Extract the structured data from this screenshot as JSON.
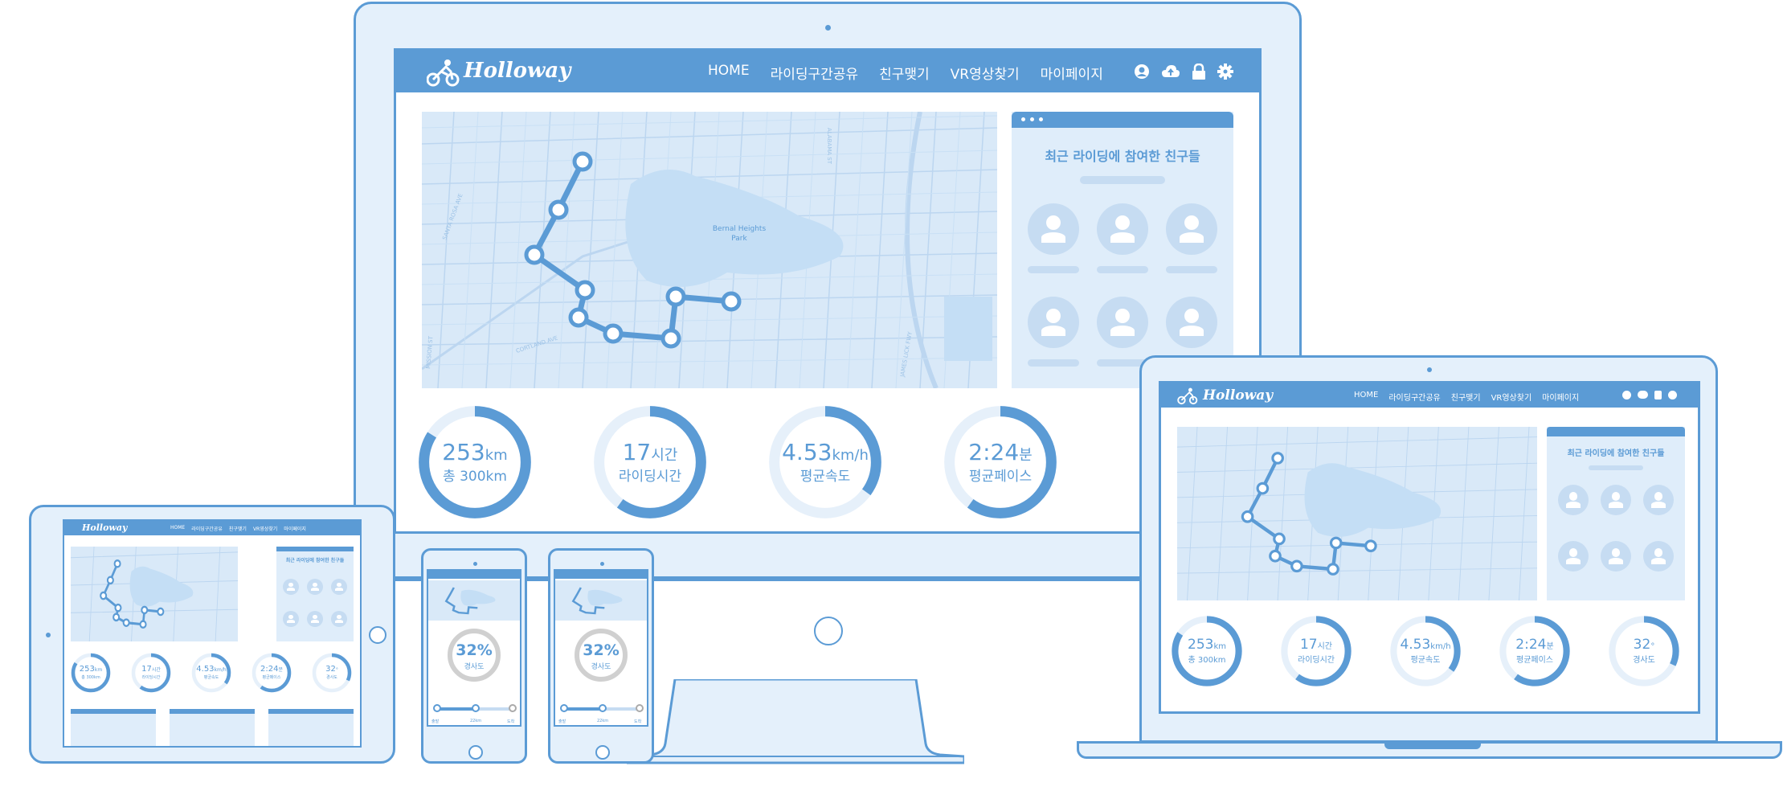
{
  "brand": {
    "name": "Holloway"
  },
  "nav": {
    "items": [
      "HOME",
      "라이딩구간공유",
      "친구맺기",
      "VR영상찾기",
      "마이페이지"
    ]
  },
  "friends_card": {
    "title": "최근 라이딩에 참여한 친구들"
  },
  "map": {
    "park_label": "Bernal Heights\nPark",
    "streets": [
      "CORTLAND AVE",
      "SANTA ROSA AVE",
      "MISSION ST",
      "JAMES LICK FWY",
      "ALABAMA ST"
    ]
  },
  "stats": [
    {
      "value": "253",
      "unit": "km",
      "caption": "총 300km",
      "fraction": 0.84
    },
    {
      "value": "17",
      "unit": "시간",
      "caption": "라이딩시간",
      "fraction": 0.6
    },
    {
      "value": "4.53",
      "unit": "km/h",
      "caption": "평균속도",
      "fraction": 0.35
    },
    {
      "value": "2:24",
      "unit": "분",
      "caption": "평균페이스",
      "fraction": 0.6
    },
    {
      "value": "32",
      "unit": "°",
      "caption": "경사도",
      "fraction": 0.32
    }
  ],
  "phone": {
    "gauge_value": "32%",
    "gauge_caption": "경사도",
    "slider": [
      "출발",
      "22km",
      "도착"
    ]
  },
  "colors": {
    "accent": "#5b9bd5",
    "light": "#e4f0fb",
    "map": "#d9e9f8",
    "track": "#e6f0fa"
  }
}
